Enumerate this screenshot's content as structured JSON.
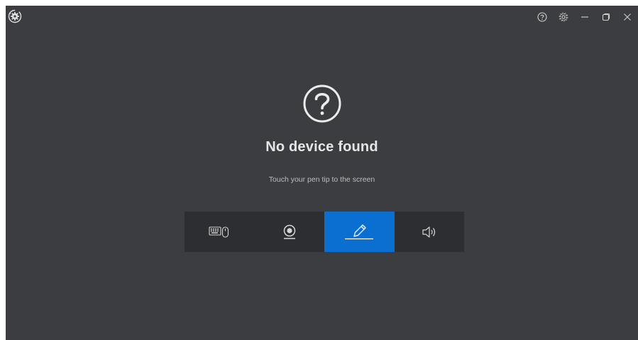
{
  "window": {
    "logo_icon": "gear-refresh-logo-icon",
    "controls": [
      {
        "name": "help",
        "icon": "question-circle-icon"
      },
      {
        "name": "settings",
        "icon": "gear-icon"
      },
      {
        "name": "minimize",
        "icon": "minimize-icon"
      },
      {
        "name": "restore",
        "icon": "restore-icon"
      },
      {
        "name": "close",
        "icon": "close-icon"
      }
    ]
  },
  "status": {
    "icon": "question-circle-icon",
    "title": "No device found",
    "hint": "Touch your pen tip to the screen"
  },
  "device_tabs": [
    {
      "name": "keyboard-mouse",
      "icon": "keyboard-mouse-icon",
      "active": false
    },
    {
      "name": "webcam",
      "icon": "webcam-icon",
      "active": false
    },
    {
      "name": "pen",
      "icon": "pen-icon",
      "active": true
    },
    {
      "name": "speaker",
      "icon": "speaker-icon",
      "active": false
    }
  ],
  "colors": {
    "background": "#3c3d40",
    "tab_bar": "#2d2e31",
    "accent": "#0a6fd0",
    "text": "#e6e6e6"
  }
}
